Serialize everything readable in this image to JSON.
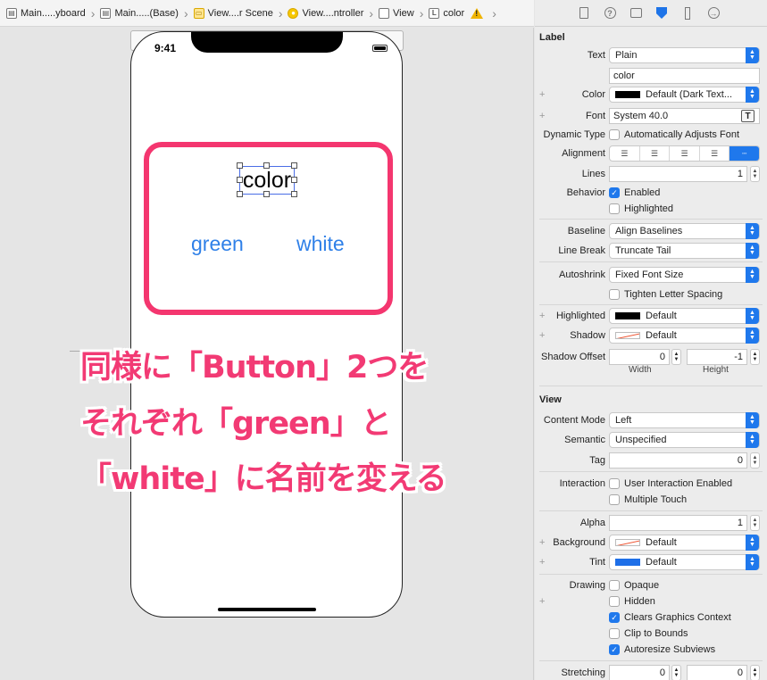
{
  "breadcrumb": {
    "items": [
      {
        "label": "Main.....yboard",
        "icon": "storyboard-icon"
      },
      {
        "label": "Main.....(Base)",
        "icon": "storyboard-icon"
      },
      {
        "label": "View....r Scene",
        "icon": "scene-icon"
      },
      {
        "label": "View....ntroller",
        "icon": "view-controller-icon"
      },
      {
        "label": "View",
        "icon": "view-icon"
      },
      {
        "label": "color",
        "icon": "label-icon"
      }
    ],
    "label_icon_glyph": "L"
  },
  "device": {
    "time": "9:41",
    "label_text": "color",
    "button_green": "green",
    "button_white": "white"
  },
  "overlay": {
    "line1": "同様に「Button」2つを",
    "line2": "それぞれ「green」と",
    "line3": "「white」に名前を変える",
    "color": "#f23a74"
  },
  "inspector": {
    "label_section": "Label",
    "text_label": "Text",
    "text_value": "Plain",
    "text_content": "color",
    "color_label": "Color",
    "color_value": "Default (Dark Text...",
    "font_label": "Font",
    "font_value": "System 40.0",
    "font_btn": "T",
    "dynamic_type_label": "Dynamic Type",
    "dynamic_type_value": "Automatically Adjusts Font",
    "alignment_label": "Alignment",
    "lines_label": "Lines",
    "lines_value": "1",
    "behavior_label": "Behavior",
    "enabled": "Enabled",
    "highlighted": "Highlighted",
    "baseline_label": "Baseline",
    "baseline_value": "Align Baselines",
    "linebreak_label": "Line Break",
    "linebreak_value": "Truncate Tail",
    "autoshrink_label": "Autoshrink",
    "autoshrink_value": "Fixed Font Size",
    "tighten": "Tighten Letter Spacing",
    "highlighted_label": "Highlighted",
    "highlighted_value": "Default",
    "shadow_label": "Shadow",
    "shadow_value": "Default",
    "shadow_offset_label": "Shadow Offset",
    "shadow_w": "0",
    "shadow_h": "-1",
    "width_label": "Width",
    "height_label": "Height",
    "view_section": "View",
    "content_mode_label": "Content Mode",
    "content_mode_value": "Left",
    "semantic_label": "Semantic",
    "semantic_value": "Unspecified",
    "tag_label": "Tag",
    "tag_value": "0",
    "interaction_label": "Interaction",
    "user_interaction": "User Interaction Enabled",
    "multiple_touch": "Multiple Touch",
    "alpha_label": "Alpha",
    "alpha_value": "1",
    "background_label": "Background",
    "background_value": "Default",
    "tint_label": "Tint",
    "tint_value": "Default",
    "drawing_label": "Drawing",
    "opaque": "Opaque",
    "hidden": "Hidden",
    "clears": "Clears Graphics Context",
    "clip": "Clip to Bounds",
    "autoresize": "Autoresize Subviews",
    "stretching_label": "Stretching",
    "stretch_x": "0",
    "stretch_y": "0",
    "plus": "+",
    "checkmark": "✓"
  }
}
